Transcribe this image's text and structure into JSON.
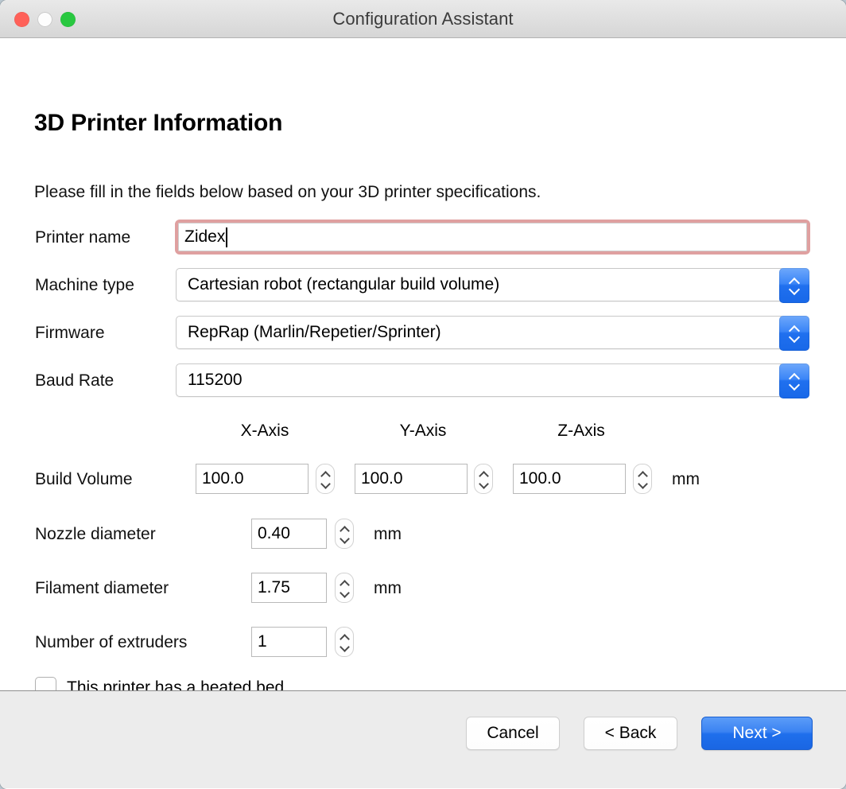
{
  "window": {
    "title": "Configuration Assistant",
    "traffic_lights": [
      {
        "name": "close-button",
        "color": "#ff6159"
      },
      {
        "name": "minimize-button",
        "color": "#fdfdfd"
      },
      {
        "name": "maximize-button",
        "color": "#29c840"
      }
    ]
  },
  "page": {
    "title": "3D Printer Information",
    "intro": "Please fill in the fields below based on your 3D printer specifications."
  },
  "fields": {
    "printer_name": {
      "label": "Printer name",
      "value": "Zidex",
      "placeholder": "",
      "focused": true,
      "focus_ring_color": "#dfa0a0"
    },
    "machine_type": {
      "label": "Machine type",
      "value": "Cartesian robot (rectangular build volume)"
    },
    "firmware": {
      "label": "Firmware",
      "value": "RepRap (Marlin/Repetier/Sprinter)"
    },
    "baud_rate": {
      "label": "Baud Rate",
      "value": "115200"
    },
    "build_volume": {
      "label": "Build Volume",
      "axis_headers": [
        "X-Axis",
        "Y-Axis",
        "Z-Axis"
      ],
      "values": [
        "100.0",
        "100.0",
        "100.0"
      ],
      "unit": "mm"
    },
    "nozzle_diameter": {
      "label": "Nozzle diameter",
      "value": "0.40",
      "unit": "mm"
    },
    "filament_diameter": {
      "label": "Filament diameter",
      "value": "1.75",
      "unit": "mm"
    },
    "number_of_extruders": {
      "label": "Number of extruders",
      "value": "1"
    },
    "heated_bed": {
      "label": "This printer has a heated bed",
      "checked": false
    }
  },
  "footer": {
    "cancel_label": "Cancel",
    "back_label": "< Back",
    "next_label": "Next >",
    "accent_color": "#1f6fec"
  }
}
